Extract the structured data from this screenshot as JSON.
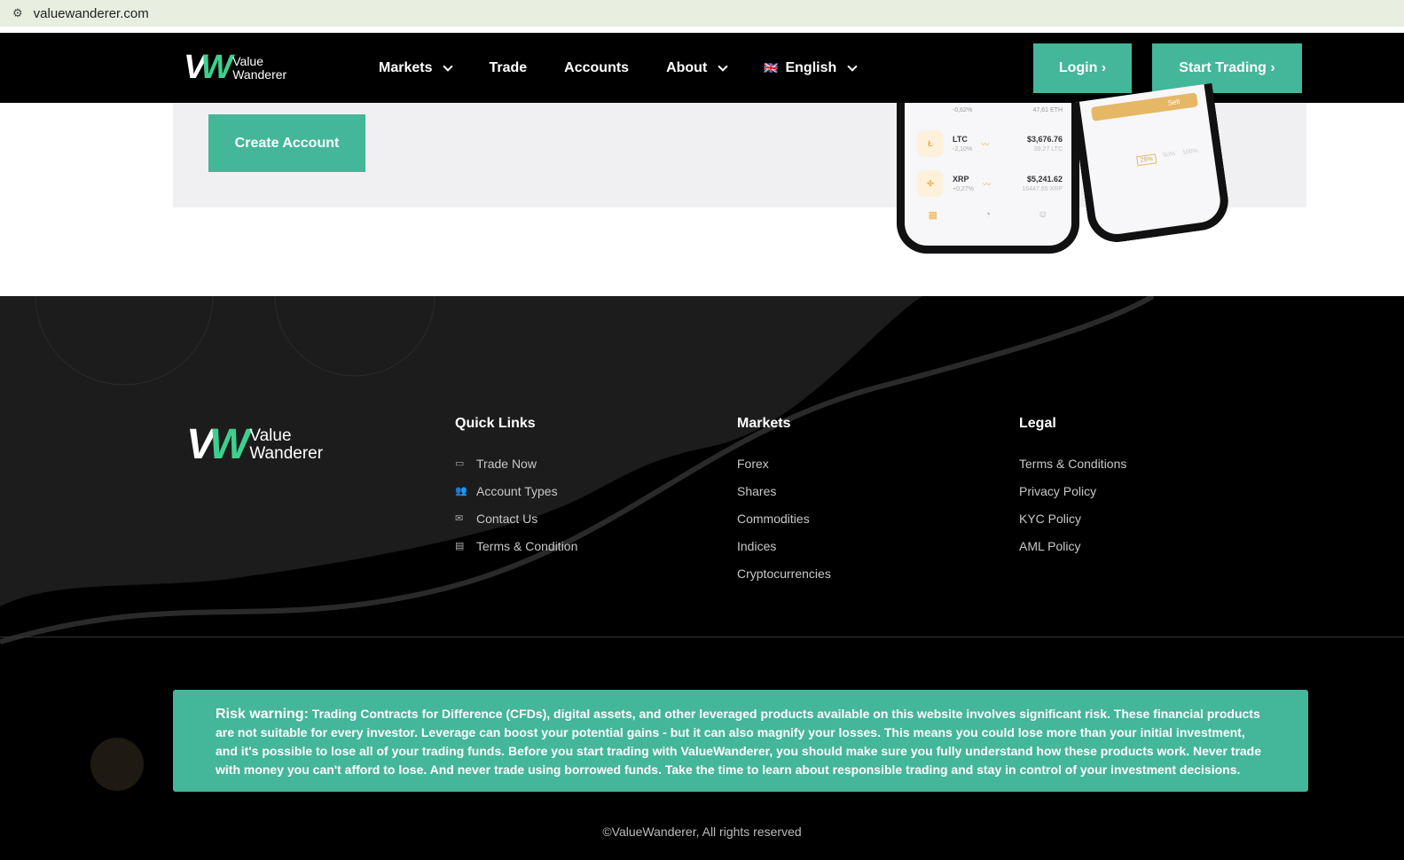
{
  "browser": {
    "url": "valuewanderer.com"
  },
  "brand": {
    "line1": "Value",
    "line2": "Wanderer"
  },
  "nav": {
    "items": [
      {
        "label": "Markets",
        "dropdown": true
      },
      {
        "label": "Trade"
      },
      {
        "label": "Accounts"
      },
      {
        "label": "About",
        "dropdown": true
      },
      {
        "label": "English",
        "dropdown": true,
        "flag": "🇬🇧"
      }
    ],
    "login": "Login",
    "start": "Start Trading"
  },
  "hero": {
    "create_account": "Create Account",
    "phone": {
      "rows": [
        {
          "sym": "LTC",
          "chg": "-2,10%",
          "price": "$3,676.76",
          "amt": "39,27 LTC"
        },
        {
          "sym": "XRP",
          "chg": "+0,27%",
          "price": "$5,241.62",
          "amt": "16447,65 XRP"
        }
      ],
      "top_row": {
        "chg": "-0,62%",
        "amt": "47,61 ETH"
      },
      "sell": "Sell",
      "pcts": [
        "25%",
        "50%",
        "100%"
      ]
    }
  },
  "footer": {
    "quick_links": {
      "title": "Quick Links",
      "items": [
        "Trade Now",
        "Account Types",
        "Contact Us",
        "Terms & Condition"
      ]
    },
    "markets": {
      "title": "Markets",
      "items": [
        "Forex",
        "Shares",
        "Commodities",
        "Indices",
        "Cryptocurrencies"
      ]
    },
    "legal": {
      "title": "Legal",
      "items": [
        "Terms & Conditions",
        "Privacy Policy",
        "KYC Policy",
        "AML Policy"
      ]
    },
    "risk_label": "Risk warning:",
    "risk_text": "Trading Contracts for Difference (CFDs), digital assets, and other leveraged products available on this website involves significant risk. These financial products are not suitable for every investor. Leverage can boost your potential gains - but it can also magnify your losses. This means you could lose more than your initial investment, and it's possible to lose all of your trading funds. Before you start trading with ValueWanderer, you should make sure you fully understand how these products work. Never trade with money you can't afford to lose. And never trade using borrowed funds. Take the time to learn about responsible trading and stay in control of your investment decisions.",
    "copyright": "©ValueWanderer, All rights reserved"
  },
  "colors": {
    "accent": "#44b69a",
    "brand_green": "#3ecf8e"
  }
}
